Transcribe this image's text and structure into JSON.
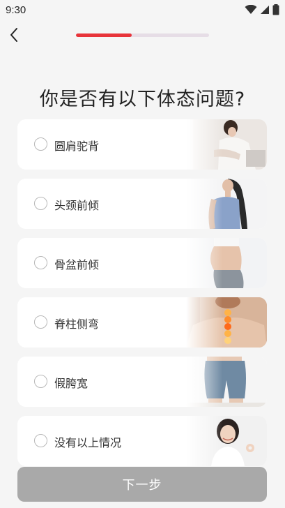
{
  "status_bar": {
    "time": "9:30"
  },
  "progress": {
    "fraction": 0.42,
    "accent_color": "#e8343a"
  },
  "question": "你是否有以下体态问题?",
  "options": [
    {
      "label": "圆肩驼背",
      "image": "woman-hunched-over-laptop"
    },
    {
      "label": "头颈前倾",
      "image": "woman-side-profile-forward-head"
    },
    {
      "label": "骨盆前倾",
      "image": "torso-anterior-pelvic-tilt"
    },
    {
      "label": "脊柱侧弯",
      "image": "spine-highlight-back"
    },
    {
      "label": "假胯宽",
      "image": "hips-in-shorts"
    },
    {
      "label": "没有以上情况",
      "image": "smiling-woman-ok-gesture"
    }
  ],
  "next_button": {
    "label": "下一步"
  }
}
